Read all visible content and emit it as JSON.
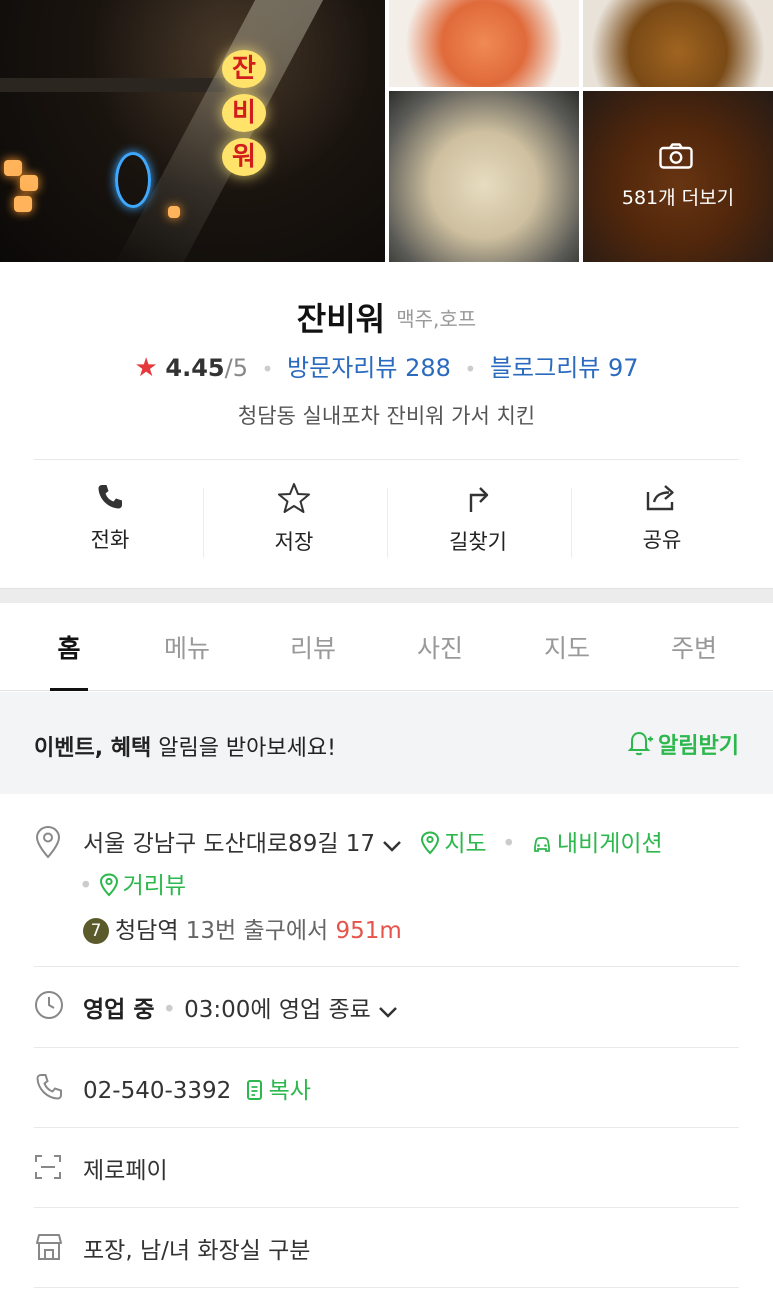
{
  "gallery": {
    "more_label": "581개 더보기",
    "sign_chars": [
      "잔",
      "비",
      "워"
    ]
  },
  "header": {
    "name": "잔비워",
    "category": "맥주,호프",
    "rating": "4.45",
    "rating_max": "/5",
    "visitor_reviews": "방문자리뷰 288",
    "blog_reviews": "블로그리뷰 97",
    "description": "청담동 실내포차 잔비워 가서 치킨"
  },
  "actions": [
    {
      "label": "전화",
      "icon": "phone-icon"
    },
    {
      "label": "저장",
      "icon": "star-outline-icon"
    },
    {
      "label": "길찾기",
      "icon": "directions-icon"
    },
    {
      "label": "공유",
      "icon": "share-icon"
    }
  ],
  "tabs": [
    "홈",
    "메뉴",
    "리뷰",
    "사진",
    "지도",
    "주변"
  ],
  "active_tab": "홈",
  "alert": {
    "bold": "이벤트, 혜택",
    "text": " 알림을 받아보세요!",
    "button": "알림받기"
  },
  "info": {
    "address": "서울 강남구 도산대로89길 17",
    "map_link": "지도",
    "navigation_link": "내비게이션",
    "streetview_link": "거리뷰",
    "subway_line": "7",
    "station": "청담역",
    "exit_text": " 13번 출구에서 ",
    "distance": "951m",
    "status": "영업 중",
    "hours": "03:00에 영업 종료",
    "phone": "02-540-3392",
    "copy_label": "복사",
    "payment": "제로페이",
    "amenities": "포장, 남/녀 화장실 구분"
  },
  "colors": {
    "accent_green": "#2db84d",
    "link_blue": "#2a6bbf",
    "star_red": "#e5383b",
    "distance_red": "#e5534b"
  }
}
